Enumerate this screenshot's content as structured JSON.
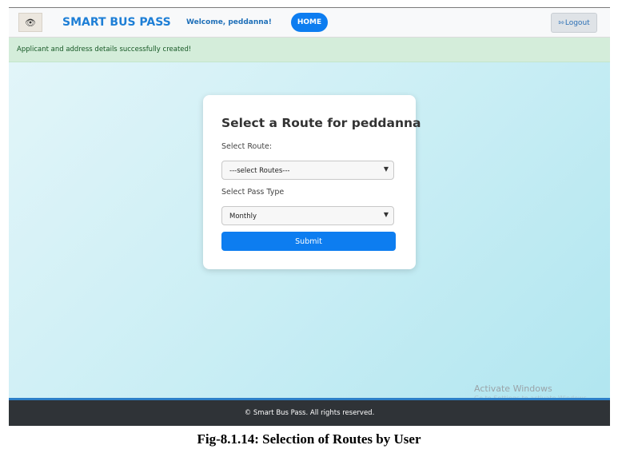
{
  "navbar": {
    "logo_icon": "eye-logo-icon",
    "brand": "SMART BUS PASS",
    "welcome": "Welcome, peddanna!",
    "home_label": "HOME",
    "logout_label": "Logout",
    "logout_icon": "logout-icon"
  },
  "alert": {
    "message": "Applicant and address details successfully created!"
  },
  "form": {
    "title": "Select a Route for peddanna",
    "route_label": "Select Route:",
    "route_value": "---select Routes---",
    "pass_type_label": "Select Pass Type",
    "pass_type_value": "Monthly",
    "submit_label": "Submit"
  },
  "watermark": {
    "title": "Activate Windows",
    "subtitle": "Go to Settings to activate Windows."
  },
  "footer": {
    "text": "© Smart Bus Pass. All rights reserved."
  },
  "caption": "Fig-8.1.14: Selection of Routes by User",
  "colors": {
    "brand": "#1e7fd6",
    "primary": "#0d7df0",
    "alert_bg": "#d4edda",
    "footer_bg": "#2f3337"
  }
}
